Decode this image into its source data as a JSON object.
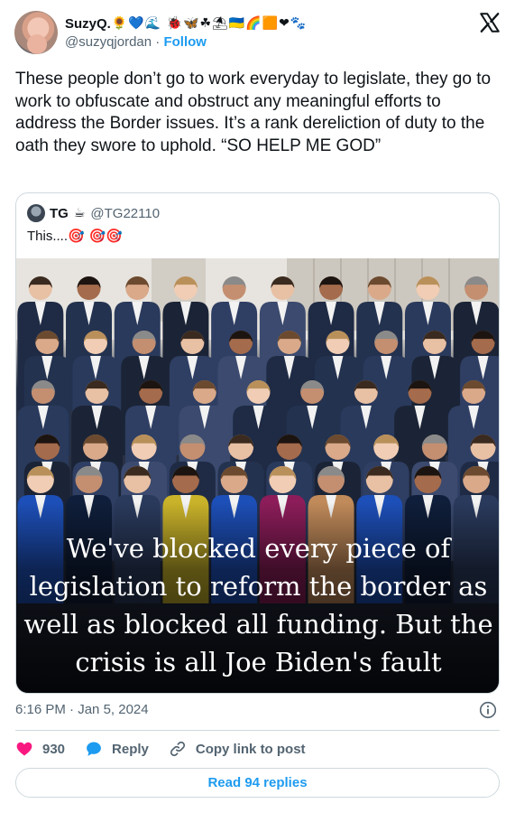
{
  "author": {
    "display_name": "SuzyQ.",
    "name_emojis": "🌻💙🌊 🐞🦋☘⛱🇺🇦🌈🟧❤🐾",
    "handle": "@suzyqjordan",
    "separator": "·",
    "follow_label": "Follow"
  },
  "platform": {
    "logo": "x-logo-icon"
  },
  "tweet": {
    "text": "These people don’t go to work everyday to legislate, they go to work to obfuscate and obstruct any meaningful efforts to address the Border issues. It’s a rank dereliction of duty to the oath they swore to uphold. “SO HELP ME GOD”"
  },
  "quoted": {
    "display_name": "TG",
    "name_emoji": "☕",
    "handle": "@TG22110",
    "text": "This....",
    "text_emojis": "🎯 🎯🎯",
    "image_caption_lines": [
      "We've blocked every piece of",
      "legislation to reform the border as",
      "well as blocked all funding. But the",
      "crisis is all Joe Biden's fault"
    ]
  },
  "meta": {
    "time": "6:16 PM",
    "separator": "·",
    "date": "Jan 5, 2024"
  },
  "actions": {
    "like_count": "930",
    "reply_label": "Reply",
    "copy_link_label": "Copy link to post"
  },
  "read_replies_label": "Read 94 replies",
  "colors": {
    "accent": "#1d9bf0",
    "like": "#f91880",
    "muted": "#536471",
    "border": "#cfd9de"
  }
}
